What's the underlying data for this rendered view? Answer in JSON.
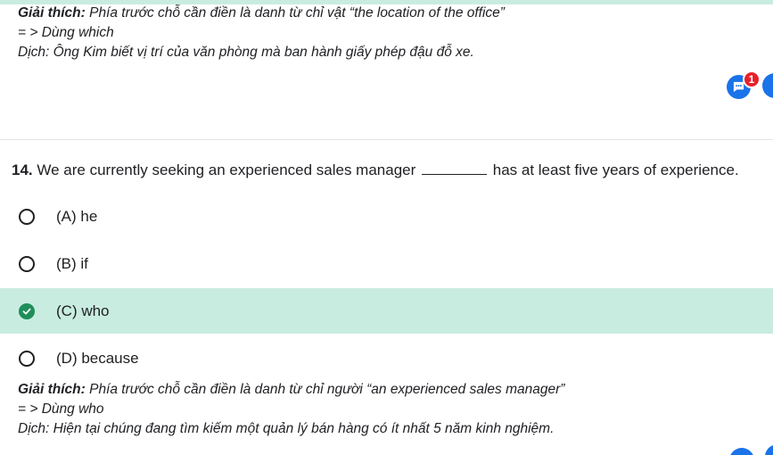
{
  "previous_explanation": {
    "label": "Giải thích:",
    "text": " Phía trước chỗ cần điền là danh từ chỉ vật “the location of the office”",
    "use_line": "= > Dùng which",
    "translation": "Dịch: Ông Kim biết vị trí của văn phòng mà ban hành giấy phép đậu đỗ xe."
  },
  "floating": {
    "chat_badge_count": "1",
    "chat_icon": "chat-bubble-icon"
  },
  "question": {
    "number": "14.",
    "text_before": " We are currently seeking an experienced sales manager",
    "text_after": " has at least five years of experience."
  },
  "options": [
    {
      "label": "(A) he",
      "selected": false
    },
    {
      "label": "(B) if",
      "selected": false
    },
    {
      "label": "(C) who",
      "selected": true
    },
    {
      "label": "(D) because",
      "selected": false
    }
  ],
  "explanation": {
    "label": "Giải thích:",
    "text": " Phía trước chỗ cần điền là danh từ chỉ người “an experienced sales manager”",
    "use_line": "= > Dùng who",
    "translation": "Dịch: Hiện tại chúng đang tìm kiếm một quản lý bán hàng có ít nhất 5 năm kinh nghiệm."
  },
  "colors": {
    "selected_bg": "#c9ece0",
    "check": "#1e8e5a",
    "accent": "#1a73e8",
    "badge": "#e8202a"
  }
}
